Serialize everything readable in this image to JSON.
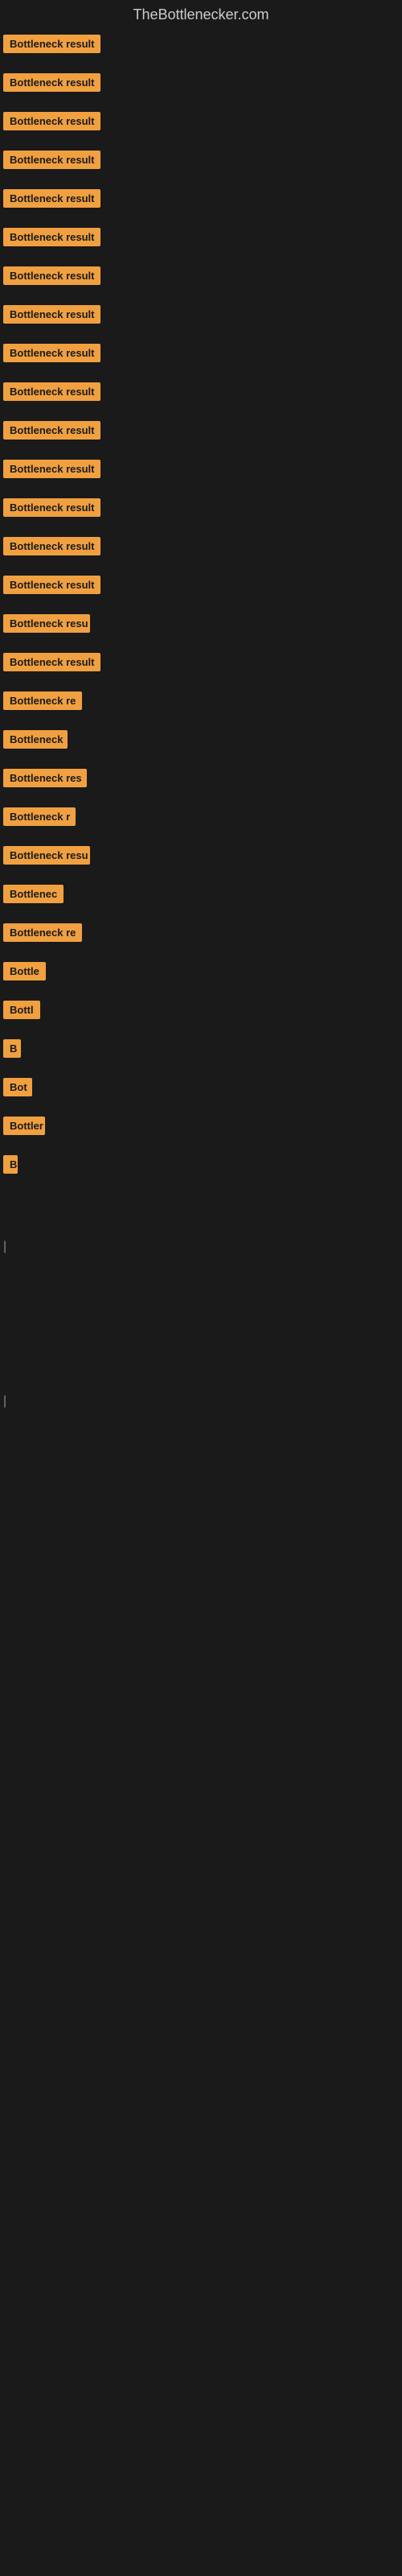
{
  "site": {
    "title": "TheBottlenecker.com"
  },
  "items": [
    {
      "id": 1,
      "label": "Bottleneck result",
      "width": 130
    },
    {
      "id": 2,
      "label": "Bottleneck result",
      "width": 130
    },
    {
      "id": 3,
      "label": "Bottleneck result",
      "width": 130
    },
    {
      "id": 4,
      "label": "Bottleneck result",
      "width": 130
    },
    {
      "id": 5,
      "label": "Bottleneck result",
      "width": 130
    },
    {
      "id": 6,
      "label": "Bottleneck result",
      "width": 130
    },
    {
      "id": 7,
      "label": "Bottleneck result",
      "width": 130
    },
    {
      "id": 8,
      "label": "Bottleneck result",
      "width": 130
    },
    {
      "id": 9,
      "label": "Bottleneck result",
      "width": 130
    },
    {
      "id": 10,
      "label": "Bottleneck result",
      "width": 130
    },
    {
      "id": 11,
      "label": "Bottleneck result",
      "width": 130
    },
    {
      "id": 12,
      "label": "Bottleneck result",
      "width": 128
    },
    {
      "id": 13,
      "label": "Bottleneck result",
      "width": 126
    },
    {
      "id": 14,
      "label": "Bottleneck result",
      "width": 124
    },
    {
      "id": 15,
      "label": "Bottleneck result",
      "width": 122
    },
    {
      "id": 16,
      "label": "Bottleneck resu",
      "width": 108
    },
    {
      "id": 17,
      "label": "Bottleneck result",
      "width": 122
    },
    {
      "id": 18,
      "label": "Bottleneck re",
      "width": 100
    },
    {
      "id": 19,
      "label": "Bottleneck",
      "width": 80
    },
    {
      "id": 20,
      "label": "Bottleneck res",
      "width": 104
    },
    {
      "id": 21,
      "label": "Bottleneck r",
      "width": 90
    },
    {
      "id": 22,
      "label": "Bottleneck resu",
      "width": 108
    },
    {
      "id": 23,
      "label": "Bottlenec",
      "width": 75
    },
    {
      "id": 24,
      "label": "Bottleneck re",
      "width": 100
    },
    {
      "id": 25,
      "label": "Bottle",
      "width": 55
    },
    {
      "id": 26,
      "label": "Bottl",
      "width": 48
    },
    {
      "id": 27,
      "label": "B",
      "width": 22
    },
    {
      "id": 28,
      "label": "Bot",
      "width": 36
    },
    {
      "id": 29,
      "label": "Bottler",
      "width": 52
    },
    {
      "id": 30,
      "label": "B",
      "width": 18
    },
    {
      "id": 31,
      "label": "",
      "width": 0
    },
    {
      "id": 32,
      "label": "|",
      "width": 10
    },
    {
      "id": 33,
      "label": "",
      "width": 0
    },
    {
      "id": 34,
      "label": "",
      "width": 0
    },
    {
      "id": 35,
      "label": "",
      "width": 0
    },
    {
      "id": 36,
      "label": "|",
      "width": 10
    }
  ]
}
